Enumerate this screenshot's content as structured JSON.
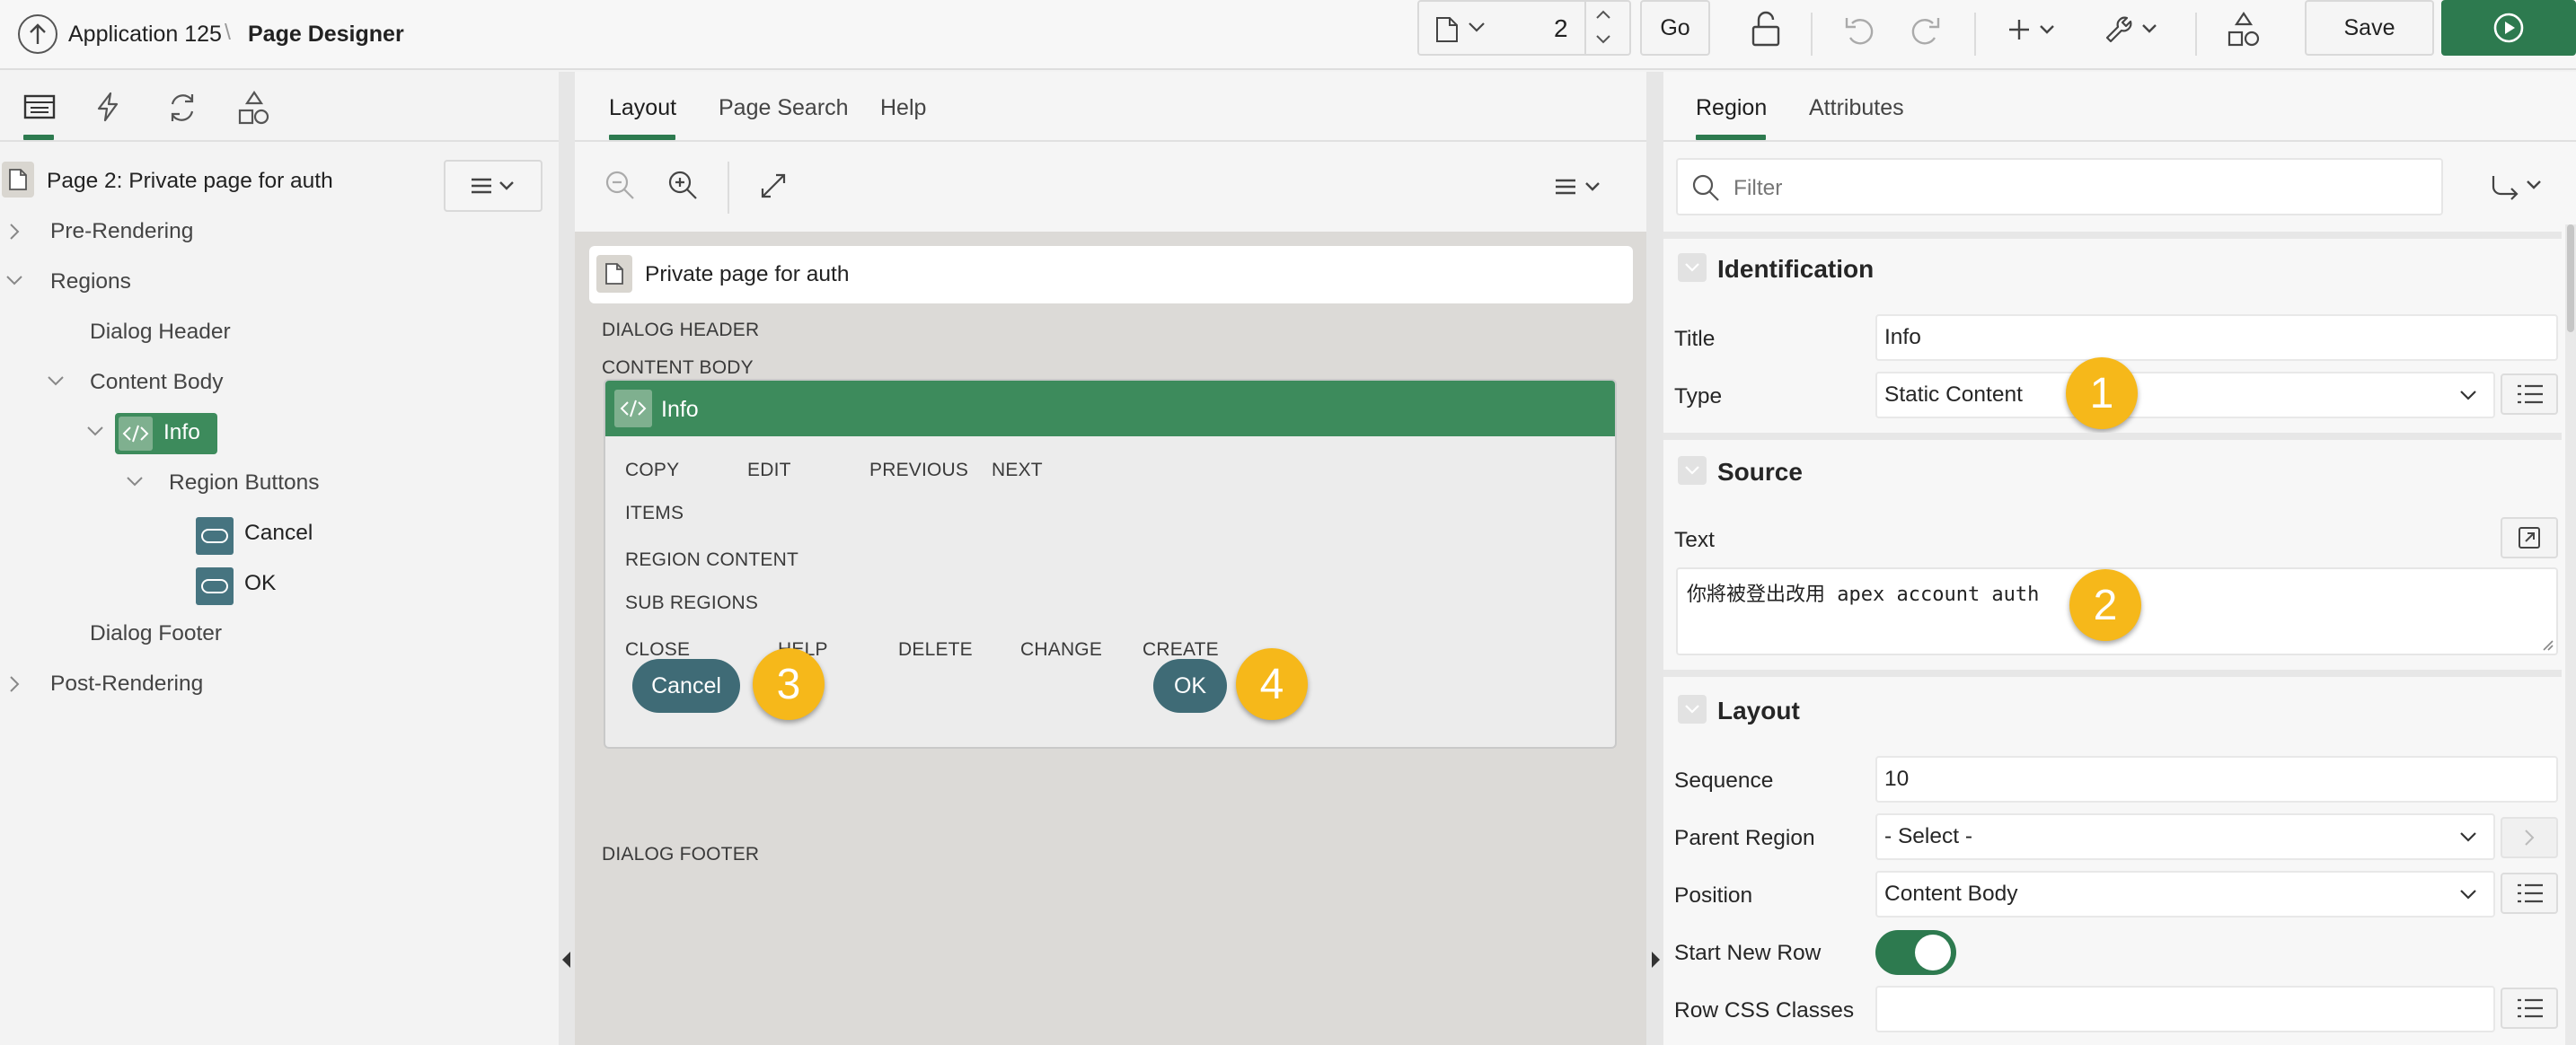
{
  "header": {
    "app_name": "Application 125",
    "separator": "\\",
    "title": "Page Designer",
    "page_number": "2",
    "go_label": "Go",
    "save_label": "Save"
  },
  "left_panel": {
    "page_title": "Page 2: Private page for auth",
    "tree": {
      "pre_rendering": "Pre-Rendering",
      "regions": "Regions",
      "dialog_header": "Dialog Header",
      "content_body": "Content Body",
      "info": "Info",
      "region_buttons": "Region Buttons",
      "cancel": "Cancel",
      "ok": "OK",
      "dialog_footer": "Dialog Footer",
      "post_rendering": "Post-Rendering"
    }
  },
  "center_panel": {
    "tabs": [
      "Layout",
      "Page Search",
      "Help"
    ],
    "page_title": "Private page for auth",
    "labels": {
      "dialog_header": "DIALOG HEADER",
      "content_body": "CONTENT BODY",
      "dialog_footer": "DIALOG FOOTER"
    },
    "region": {
      "title": "Info",
      "positions_row1": [
        "COPY",
        "EDIT",
        "PREVIOUS",
        "NEXT"
      ],
      "items": "ITEMS",
      "region_content": "REGION CONTENT",
      "sub_regions": "SUB REGIONS",
      "positions_row2": [
        "CLOSE",
        "HELP",
        "DELETE",
        "CHANGE",
        "CREATE"
      ],
      "cancel_button": "Cancel",
      "ok_button": "OK"
    }
  },
  "right_panel": {
    "tabs": [
      "Region",
      "Attributes"
    ],
    "filter_placeholder": "Filter",
    "sections": {
      "identification": "Identification",
      "source": "Source",
      "layout": "Layout"
    },
    "properties": {
      "title_label": "Title",
      "title_value": "Info",
      "type_label": "Type",
      "type_value": "Static Content",
      "text_label": "Text",
      "text_value": "你將被登出改用 apex account auth",
      "sequence_label": "Sequence",
      "sequence_value": "10",
      "parent_region_label": "Parent Region",
      "parent_region_value": "- Select -",
      "position_label": "Position",
      "position_value": "Content Body",
      "start_new_row_label": "Start New Row",
      "start_new_row_value": "on",
      "row_css_label": "Row CSS Classes",
      "row_css_value": ""
    }
  },
  "callouts": [
    "1",
    "2",
    "3",
    "4"
  ],
  "colors": {
    "accent_green": "#2d7a4f",
    "region_header": "#3d8b5c",
    "button_teal": "#3f6b76",
    "callout_yellow": "#f6b81a"
  }
}
